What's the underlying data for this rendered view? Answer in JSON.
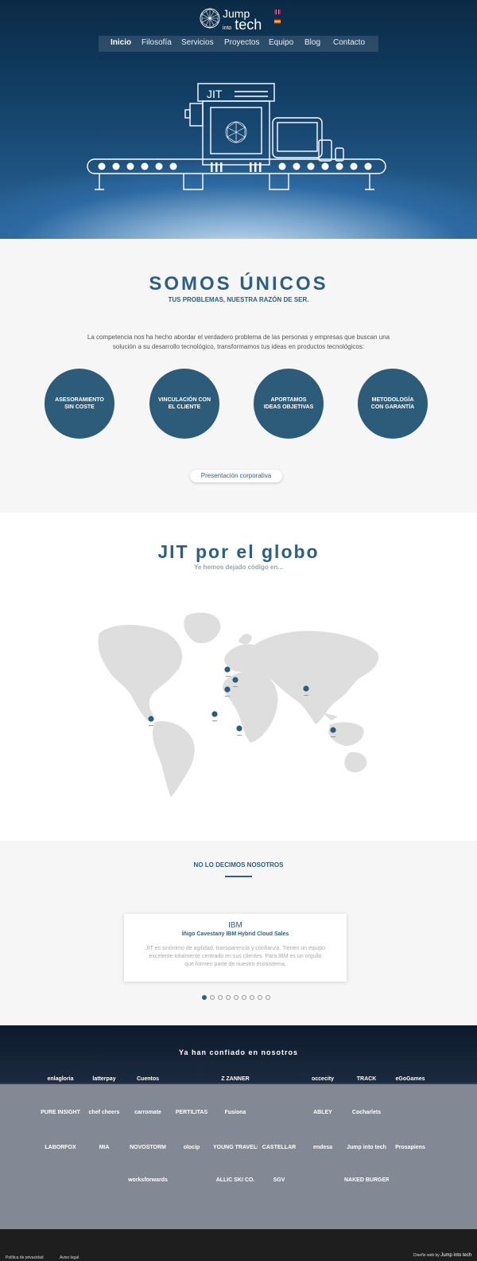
{
  "header": {
    "logo_top": "Jump",
    "logo_mid": "into",
    "logo_bottom": "tech",
    "lang_en": "English",
    "lang_es": "Español",
    "nav": [
      "Inicio",
      "Filosofía",
      "Servicios",
      "Proyectos",
      "Equipo",
      "Blog",
      "Contacto"
    ],
    "active_nav": "Inicio",
    "hero_sign": "JIT"
  },
  "somos": {
    "title": "SOMOS ÚNICOS",
    "subtitle": "TUS PROBLEMAS, NUESTRA RAZÓN DE SER.",
    "intro": "La competencia nos ha hecho abordar el verdadero problema de las personas y empresas que buscan una solución a su desarrollo tecnológico, transformamos tus ideas en productos tecnológicos:",
    "circles": [
      "ASESORAMIENTO SIN COSTE",
      "VINCULACIÓN CON EL CLIENTE",
      "APORTAMOS IDEAS OBJETIVAS",
      "METODOLOGÍA CON GARANTÍA"
    ],
    "button": "Presentación corporativa"
  },
  "globo": {
    "title": "JIT por el globo",
    "subtitle": "Ye hemos dejado código en..."
  },
  "testimonials": {
    "title": "NO LO DECIMOS NOSOTROS",
    "company": "IBM",
    "person": "Íñigo Cavestany IBM Hybrid Cloud Sales",
    "quote": "JIT es sinónimo de agilidad, transparencia y confianza. Tienen un equipo excelente totalmente centrado en sus clientes. Para IBM es un orgullo que formen parte de nuestro ecosistema.",
    "slides": 10,
    "active_slide": 1
  },
  "clients": {
    "title": "Ya han confiado en nosotros",
    "logos": [
      "enlagloria",
      "latterpay",
      "Cuentos",
      "",
      "Z ZANNER",
      "",
      "occecity",
      "TRACK",
      "eGoGames",
      "PURE INSIGHT",
      "chef cheers",
      "carromate",
      "PERTILITAS",
      "Fusiona",
      "",
      "ABLEY",
      "Cocharlets",
      "",
      "LABORFOX",
      "MIA",
      "NOVOSTORM",
      "olocip",
      "YOUNG TRAVELLER",
      "CASTELLAR",
      "endesa",
      "Jump into tech",
      "Prosapiens",
      "worksforwards",
      "",
      "ALLIC SKI CO.",
      "SGV",
      "",
      "NAKED BURGER"
    ]
  },
  "footer": {
    "privacy": "Política de privacidad",
    "legal": "Aviso legal",
    "credit": "Diseño web by",
    "credit_logo": "Jump into tech"
  }
}
